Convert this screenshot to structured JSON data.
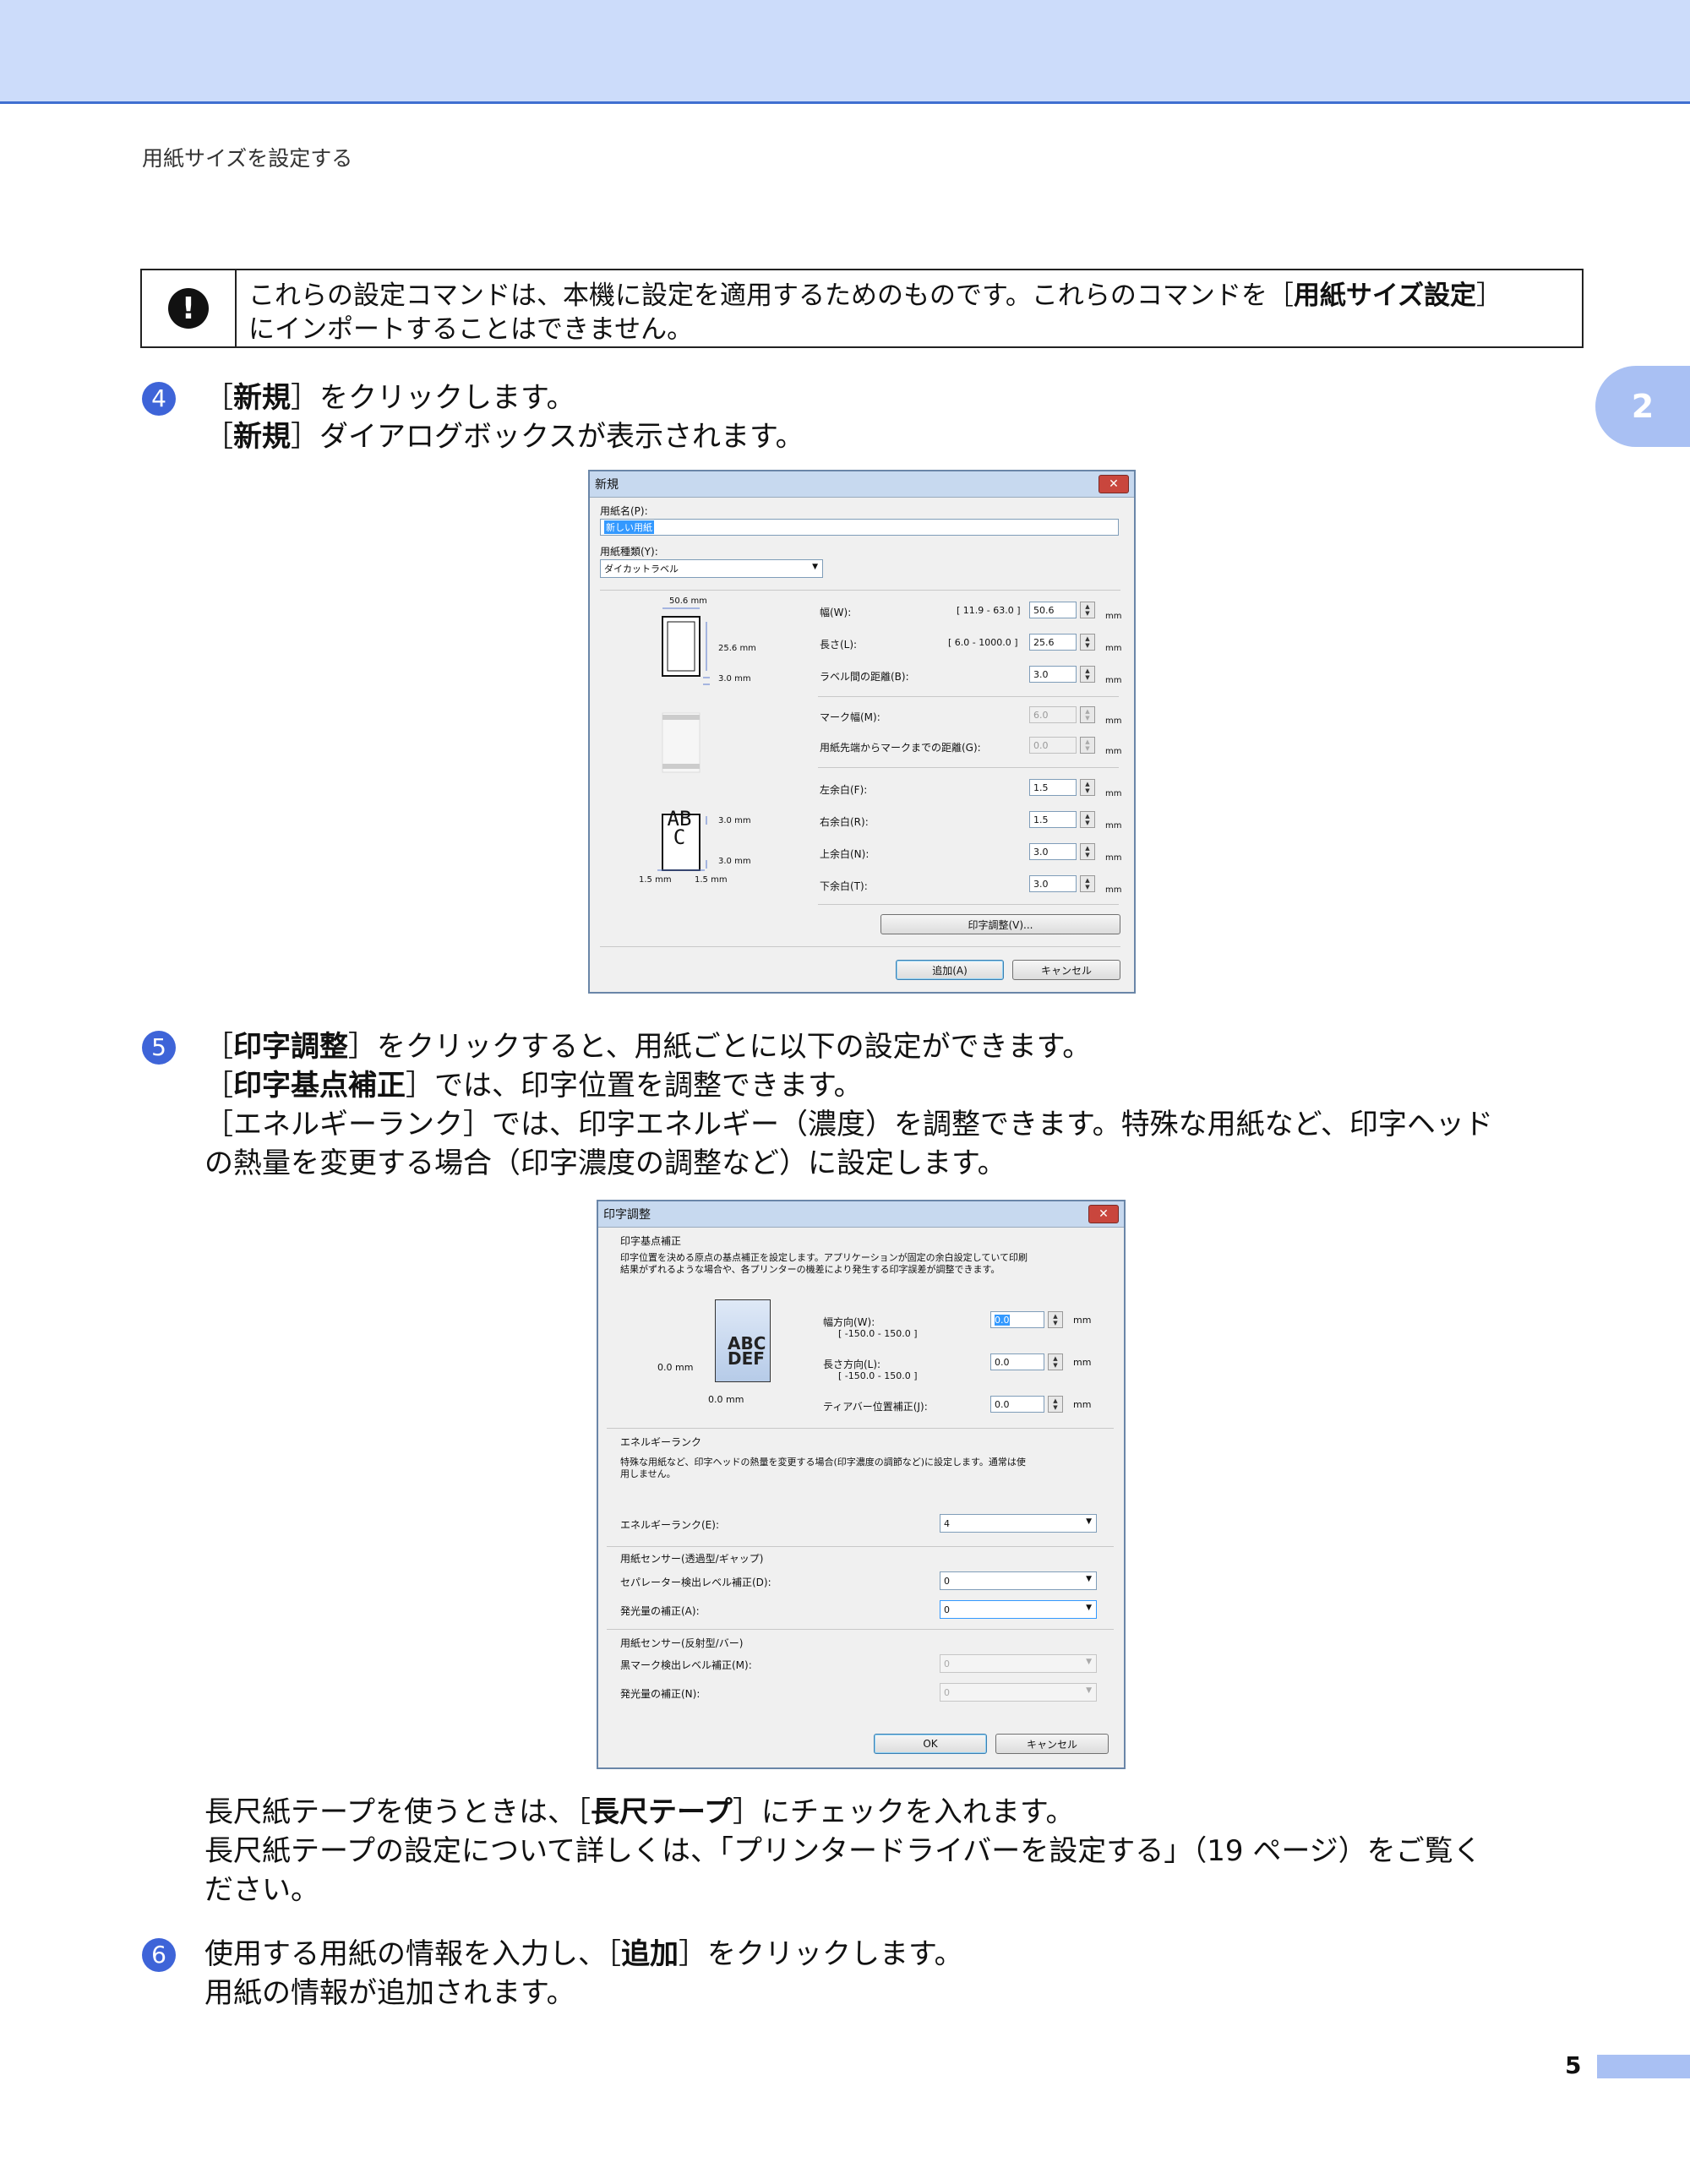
{
  "header": {
    "title": "用紙サイズを設定する"
  },
  "chapter_tab": "2",
  "note": {
    "icon": "exclamation-icon",
    "text_a": "これらの設定コマンドは、本機に設定を適用するためのものです。これらのコマンドを［",
    "bold": "用紙サイズ設定",
    "text_b": "］",
    "line2": "にインポートすることはできません。"
  },
  "step4": {
    "num": "4",
    "l1_a": "［",
    "l1_bold": "新規",
    "l1_b": "］をクリックします。",
    "l2_a": "［",
    "l2_bold": "新規",
    "l2_b": "］ダイアログボックスが表示されます。"
  },
  "dialog_new": {
    "title": "新規",
    "close": "✕",
    "paper_name_label": "用紙名(P):",
    "paper_name_value": "新しい用紙",
    "paper_type_label": "用紙種類(Y):",
    "paper_type_value": "ダイカットラベル",
    "diagram": {
      "w": "50.6 mm",
      "h": "25.6 mm",
      "gap": "3.0 mm",
      "top": "3.0 mm",
      "bottom": "3.0 mm",
      "left": "1.5 mm",
      "right": "1.5 mm",
      "abc": "ABC"
    },
    "width_label": "幅(W):",
    "width_range": "[ 11.9 - 63.0 ]",
    "width_value": "50.6",
    "length_label": "長さ(L):",
    "length_range": "[ 6.0 - 1000.0 ]",
    "length_value": "25.6",
    "gap_label": "ラベル間の距離(B):",
    "gap_value": "3.0",
    "mark_width_label": "マーク幅(M):",
    "mark_width_value": "6.0",
    "mark_dist_label": "用紙先端からマークまでの距離(G):",
    "mark_dist_value": "0.0",
    "left_label": "左余白(F):",
    "left_value": "1.5",
    "right_label": "右余白(R):",
    "right_value": "1.5",
    "top_label": "上余白(N):",
    "top_value": "3.0",
    "bottom_label": "下余白(T):",
    "bottom_value": "3.0",
    "unit": "mm",
    "print_adjust_button": "印字調整(V)...",
    "add_button": "追加(A)",
    "cancel_button": "キャンセル"
  },
  "step5": {
    "num": "5",
    "l1_a": "［",
    "l1_bold": "印字調整",
    "l1_b": "］をクリックすると、用紙ごとに以下の設定ができます。",
    "l2_a": "［",
    "l2_bold": "印字基点補正",
    "l2_b": "］では、印字位置を調整できます。",
    "l3": "［エネルギーランク］では、印字エネルギー（濃度）を調整できます。特殊な用紙など、印字ヘッド",
    "l4": "の熱量を変更する場合（印字濃度の調整など）に設定します。"
  },
  "dialog_adjust": {
    "title": "印字調整",
    "close": "✕",
    "base_group": "印字基点補正",
    "base_desc1": "印字位置を決める原点の基点補正を設定します。アプリケーションが固定の余白設定していて印刷",
    "base_desc2": "結果がずれるような場合や、各プリンターの機差により発生する印字誤差が調整できます。",
    "diag_abc": "ABC",
    "diag_def": "DEF",
    "diag_h": "0.0 mm",
    "diag_v": "0.0 mm",
    "horiz_label": "幅方向(W):",
    "horiz_range": "[ -150.0 - 150.0 ]",
    "horiz_value": "0.0",
    "vert_label": "長さ方向(L):",
    "vert_range": "[ -150.0 - 150.0 ]",
    "vert_value": "0.0",
    "tear_label": "ティアバー位置補正(J):",
    "tear_value": "0.0",
    "unit": "mm",
    "energy_group": "エネルギーランク",
    "energy_desc1": "特殊な用紙など、印字ヘッドの熱量を変更する場合(印字濃度の調節など)に設定します。通常は使",
    "energy_desc2": "用しません。",
    "energy_label": "エネルギーランク(E):",
    "energy_value": "4",
    "gap_sensor_group": "用紙センサー(透過型/ギャップ)",
    "sep_level_label": "セパレーター検出レベル補正(D):",
    "sep_level_value": "0",
    "emit1_label": "発光量の補正(A):",
    "emit1_value": "0",
    "refl_sensor_group": "用紙センサー(反射型/バー)",
    "black_level_label": "黒マーク検出レベル補正(M):",
    "black_level_value": "0",
    "emit2_label": "発光量の補正(N):",
    "emit2_value": "0",
    "ok_button": "OK",
    "cancel_button": "キャンセル"
  },
  "long_tape": {
    "l1_a": "長尺紙テープを使うときは、［",
    "l1_bold": "長尺テープ",
    "l1_b": "］にチェックを入れます。",
    "l2": "長尺紙テープの設定について詳しくは、「プリンタードライバーを設定する」（19 ページ）をご覧く",
    "l3": "ださい。"
  },
  "step6": {
    "num": "6",
    "l1_a": "使用する用紙の情報を入力し、［",
    "l1_bold": "追加",
    "l1_b": "］をクリックします。",
    "l2": "用紙の情報が追加されます。"
  },
  "footer": {
    "page_number": "5"
  }
}
